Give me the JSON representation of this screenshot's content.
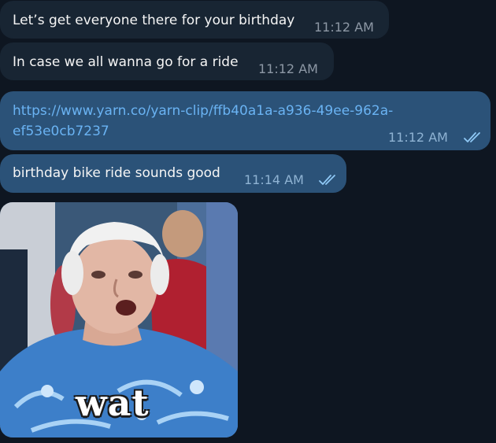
{
  "messages": [
    {
      "text": "Let’s get everyone there for your birthday",
      "time": "11:12 AM"
    },
    {
      "text": "In case we all wanna go for a ride",
      "time": "11:12 AM"
    },
    {
      "link_line1": "https://www.yarn.co/yarn-clip/ffb40a1a-a936-49ee-962a-",
      "link_line2": "ef53e0cb7237",
      "time": "11:12 AM",
      "status_icon": "double-check-icon"
    },
    {
      "text": "birthday bike ride sounds good",
      "time": "11:14 AM",
      "status_icon": "double-check-icon"
    }
  ],
  "gif": {
    "caption": "wat"
  },
  "colors": {
    "background": "#0e1621",
    "incoming_bubble": "#182533",
    "outgoing_bubble": "#2b5278",
    "link": "#6ab3f3"
  }
}
